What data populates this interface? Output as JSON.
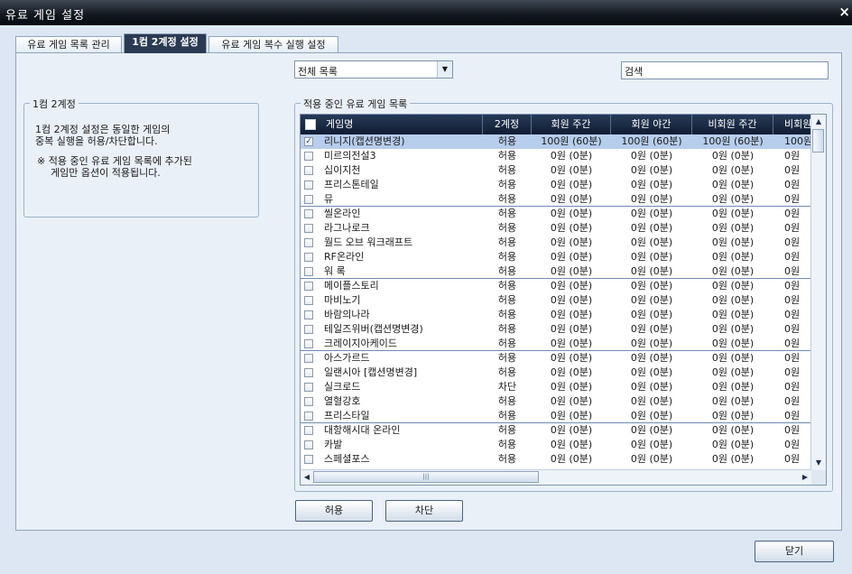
{
  "window": {
    "title": "유료 게임 설정",
    "close": "×"
  },
  "tabs": [
    "유료 게임 목록 관리",
    "1컴 2계정 설정",
    "유료 게임 복수 실행 설정"
  ],
  "filter": {
    "selected": "전체 목록",
    "search_value": "검색"
  },
  "left_group": {
    "legend": "1컴 2계정",
    "line1": "1컴 2계정 설정은 동일한 게임의",
    "line2": "중복 실행을 허용/차단합니다.",
    "note1": "※ 적용 중인 유료 게임 목록에 추가된",
    "note2": "게임만 옵션이 적용됩니다."
  },
  "list_group": {
    "legend": "적용 중인 유료 게임 목록"
  },
  "table": {
    "headers": [
      "게임명",
      "2계정",
      "회원 주간",
      "회원 야간",
      "비회원 주간",
      "비회원"
    ],
    "rows": [
      {
        "checked": true,
        "name": "리니지(캡션명변경)",
        "status": "허용",
        "v1": "100원 (60분)",
        "v2": "100원 (60분)",
        "v3": "100원 (60분)",
        "v4": "100원"
      },
      {
        "checked": false,
        "name": "미르의전설3",
        "status": "허용",
        "v1": "0원 (0분)",
        "v2": "0원 (0분)",
        "v3": "0원 (0분)",
        "v4": "0원"
      },
      {
        "checked": false,
        "name": "십이지천",
        "status": "허용",
        "v1": "0원 (0분)",
        "v2": "0원 (0분)",
        "v3": "0원 (0분)",
        "v4": "0원"
      },
      {
        "checked": false,
        "name": "프리스톤테일",
        "status": "허용",
        "v1": "0원 (0분)",
        "v2": "0원 (0분)",
        "v3": "0원 (0분)",
        "v4": "0원"
      },
      {
        "checked": false,
        "name": "뮤",
        "status": "허용",
        "v1": "0원 (0분)",
        "v2": "0원 (0분)",
        "v3": "0원 (0분)",
        "v4": "0원"
      },
      {
        "checked": false,
        "name": "씰온라인",
        "status": "허용",
        "v1": "0원 (0분)",
        "v2": "0원 (0분)",
        "v3": "0원 (0분)",
        "v4": "0원"
      },
      {
        "checked": false,
        "name": "라그나로크",
        "status": "허용",
        "v1": "0원 (0분)",
        "v2": "0원 (0분)",
        "v3": "0원 (0분)",
        "v4": "0원"
      },
      {
        "checked": false,
        "name": "월드 오브 워크래프트",
        "status": "허용",
        "v1": "0원 (0분)",
        "v2": "0원 (0분)",
        "v3": "0원 (0분)",
        "v4": "0원"
      },
      {
        "checked": false,
        "name": "RF온라인",
        "status": "허용",
        "v1": "0원 (0분)",
        "v2": "0원 (0분)",
        "v3": "0원 (0분)",
        "v4": "0원"
      },
      {
        "checked": false,
        "name": "워 록",
        "status": "허용",
        "v1": "0원 (0분)",
        "v2": "0원 (0분)",
        "v3": "0원 (0분)",
        "v4": "0원"
      },
      {
        "checked": false,
        "name": "메이플스토리",
        "status": "허용",
        "v1": "0원 (0분)",
        "v2": "0원 (0분)",
        "v3": "0원 (0분)",
        "v4": "0원"
      },
      {
        "checked": false,
        "name": "마비노기",
        "status": "허용",
        "v1": "0원 (0분)",
        "v2": "0원 (0분)",
        "v3": "0원 (0분)",
        "v4": "0원"
      },
      {
        "checked": false,
        "name": "바람의나라",
        "status": "허용",
        "v1": "0원 (0분)",
        "v2": "0원 (0분)",
        "v3": "0원 (0분)",
        "v4": "0원"
      },
      {
        "checked": false,
        "name": "테일즈위버(캡션명변경)",
        "status": "허용",
        "v1": "0원 (0분)",
        "v2": "0원 (0분)",
        "v3": "0원 (0분)",
        "v4": "0원"
      },
      {
        "checked": false,
        "name": "크레이지아케이드",
        "status": "허용",
        "v1": "0원 (0분)",
        "v2": "0원 (0분)",
        "v3": "0원 (0분)",
        "v4": "0원"
      },
      {
        "checked": false,
        "name": "아스가르드",
        "status": "허용",
        "v1": "0원 (0분)",
        "v2": "0원 (0분)",
        "v3": "0원 (0분)",
        "v4": "0원"
      },
      {
        "checked": false,
        "name": "일랜시아 [캡션명변경]",
        "status": "허용",
        "v1": "0원 (0분)",
        "v2": "0원 (0분)",
        "v3": "0원 (0분)",
        "v4": "0원"
      },
      {
        "checked": false,
        "name": "실크로드",
        "status": "차단",
        "v1": "0원 (0분)",
        "v2": "0원 (0분)",
        "v3": "0원 (0분)",
        "v4": "0원"
      },
      {
        "checked": false,
        "name": "열혈강호",
        "status": "허용",
        "v1": "0원 (0분)",
        "v2": "0원 (0분)",
        "v3": "0원 (0분)",
        "v4": "0원"
      },
      {
        "checked": false,
        "name": "프리스타일",
        "status": "허용",
        "v1": "0원 (0분)",
        "v2": "0원 (0분)",
        "v3": "0원 (0분)",
        "v4": "0원"
      },
      {
        "checked": false,
        "name": "대항해시대 온라인",
        "status": "허용",
        "v1": "0원 (0분)",
        "v2": "0원 (0분)",
        "v3": "0원 (0분)",
        "v4": "0원"
      },
      {
        "checked": false,
        "name": "카발",
        "status": "허용",
        "v1": "0원 (0분)",
        "v2": "0원 (0분)",
        "v3": "0원 (0분)",
        "v4": "0원"
      },
      {
        "checked": false,
        "name": "스페셜포스",
        "status": "허용",
        "v1": "0원 (0분)",
        "v2": "0원 (0분)",
        "v3": "0원 (0분)",
        "v4": "0원"
      }
    ]
  },
  "buttons": {
    "allow": "허용",
    "block": "차단",
    "close": "닫기"
  },
  "icons": {
    "checkbox_checked": "check-icon",
    "scroll_up": "arrow-up-icon",
    "scroll_down": "arrow-down-icon",
    "scroll_left": "arrow-left-icon",
    "scroll_right": "arrow-right-icon",
    "dropdown": "chevron-down-icon"
  },
  "colors": {
    "titlebar": "#141a22",
    "header": "#1b2b45",
    "selected_row": "#b7cdec",
    "panel": "#e9f0f8"
  }
}
